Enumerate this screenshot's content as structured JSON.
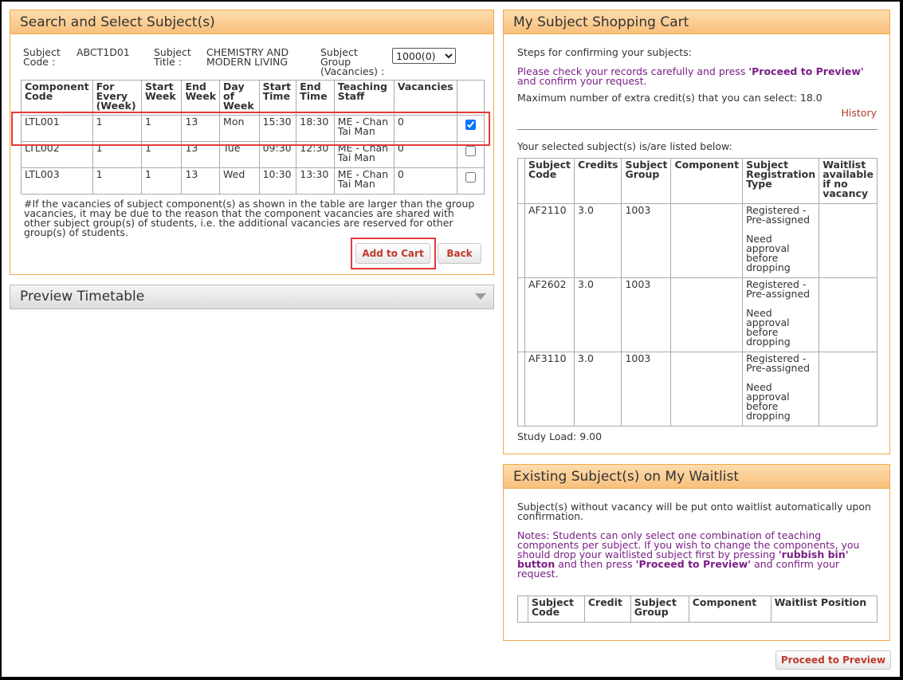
{
  "search": {
    "title": "Search and Select Subject(s)",
    "code_label": "Subject Code :",
    "code_value": "ABCT1D01",
    "title_label": "Subject Title :",
    "title_value": "CHEMISTRY AND MODERN LIVING",
    "group_label": "Subject Group (Vacancies) :",
    "group_value": "1000(0)",
    "headers": [
      "Component Code",
      "For Every (Week)",
      "Start Week",
      "End Week",
      "Day of Week",
      "Start Time",
      "End Time",
      "Teaching Staff",
      "Vacancies"
    ],
    "rows": [
      {
        "code": "LTL001",
        "every": "1",
        "start_week": "1",
        "end_week": "13",
        "day": "Mon",
        "start_time": "15:30",
        "end_time": "18:30",
        "staff": "ME - Chan Tai Man",
        "vacancies": "0",
        "checked": true
      },
      {
        "code": "LTL002",
        "every": "1",
        "start_week": "1",
        "end_week": "13",
        "day": "Tue",
        "start_time": "09:30",
        "end_time": "12:30",
        "staff": "ME - Chan Tai Man",
        "vacancies": "0",
        "checked": false
      },
      {
        "code": "LTL003",
        "every": "1",
        "start_week": "1",
        "end_week": "13",
        "day": "Wed",
        "start_time": "10:30",
        "end_time": "13:30",
        "staff": "ME - Chan Tai Man",
        "vacancies": "0",
        "checked": false
      }
    ],
    "note": "#If the vacancies of subject component(s) as shown in the table are larger than the group vacancies, it may be due to the reason that the component vacancies are shared with other subject group(s) of students, i.e. the additional vacancies are reserved for other group(s) of students.",
    "add_button": "Add to Cart",
    "back_button": "Back"
  },
  "preview": {
    "title": "Preview Timetable",
    "icon": "triangle-down-icon"
  },
  "cart": {
    "title": "My Subject Shopping Cart",
    "steps_text": "Steps for confirming your subjects:",
    "instruction_pre": "Please check your records carefully and press ",
    "instruction_bold": "'Proceed to Preview'",
    "instruction_post": " and confirm your request.",
    "max_credit": "Maximum number of extra credit(s) that you can select: 18.0",
    "history_link": "History",
    "selected_text": "Your selected subject(s) is/are listed below:",
    "headers": [
      "Subject Code",
      "Credits",
      "Subject Group",
      "Component",
      "Subject Registration Type",
      "Waitlist available if no vacancy"
    ],
    "rows": [
      {
        "code": "AF2110",
        "credits": "3.0",
        "group": "1003",
        "component": "",
        "type": "Registered - Pre-assigned",
        "approval": "Need approval before dropping",
        "waitlist": ""
      },
      {
        "code": "AF2602",
        "credits": "3.0",
        "group": "1003",
        "component": "",
        "type": "Registered - Pre-assigned",
        "approval": "Need approval before dropping",
        "waitlist": ""
      },
      {
        "code": "AF3110",
        "credits": "3.0",
        "group": "1003",
        "component": "",
        "type": "Registered - Pre-assigned",
        "approval": "Need approval before dropping",
        "waitlist": ""
      }
    ],
    "study_load": "Study Load: 9.00"
  },
  "waitlist": {
    "title": "Existing Subject(s) on My Waitlist",
    "info": "Subject(s) without vacancy will be put onto waitlist automatically upon confirmation.",
    "notes_pre": "Notes: Students can only select one combination of teaching components per subject. If you wish to change the components, you should drop your waitlisted subject first by pressing ",
    "notes_bold1": "'rubbish bin' button",
    "notes_mid": " and then press ",
    "notes_bold2": "'Proceed to Preview'",
    "notes_post": " and confirm your request.",
    "headers": [
      "Subject Code",
      "Credit",
      "Subject Group",
      "Component",
      "Waitlist Position"
    ]
  },
  "proceed_button": "Proceed to Preview",
  "colors": {
    "panel_border": "#f0a94a",
    "highlight": "#e53a3a",
    "notice_text": "#7a1f86",
    "button_text": "#c0392b"
  }
}
